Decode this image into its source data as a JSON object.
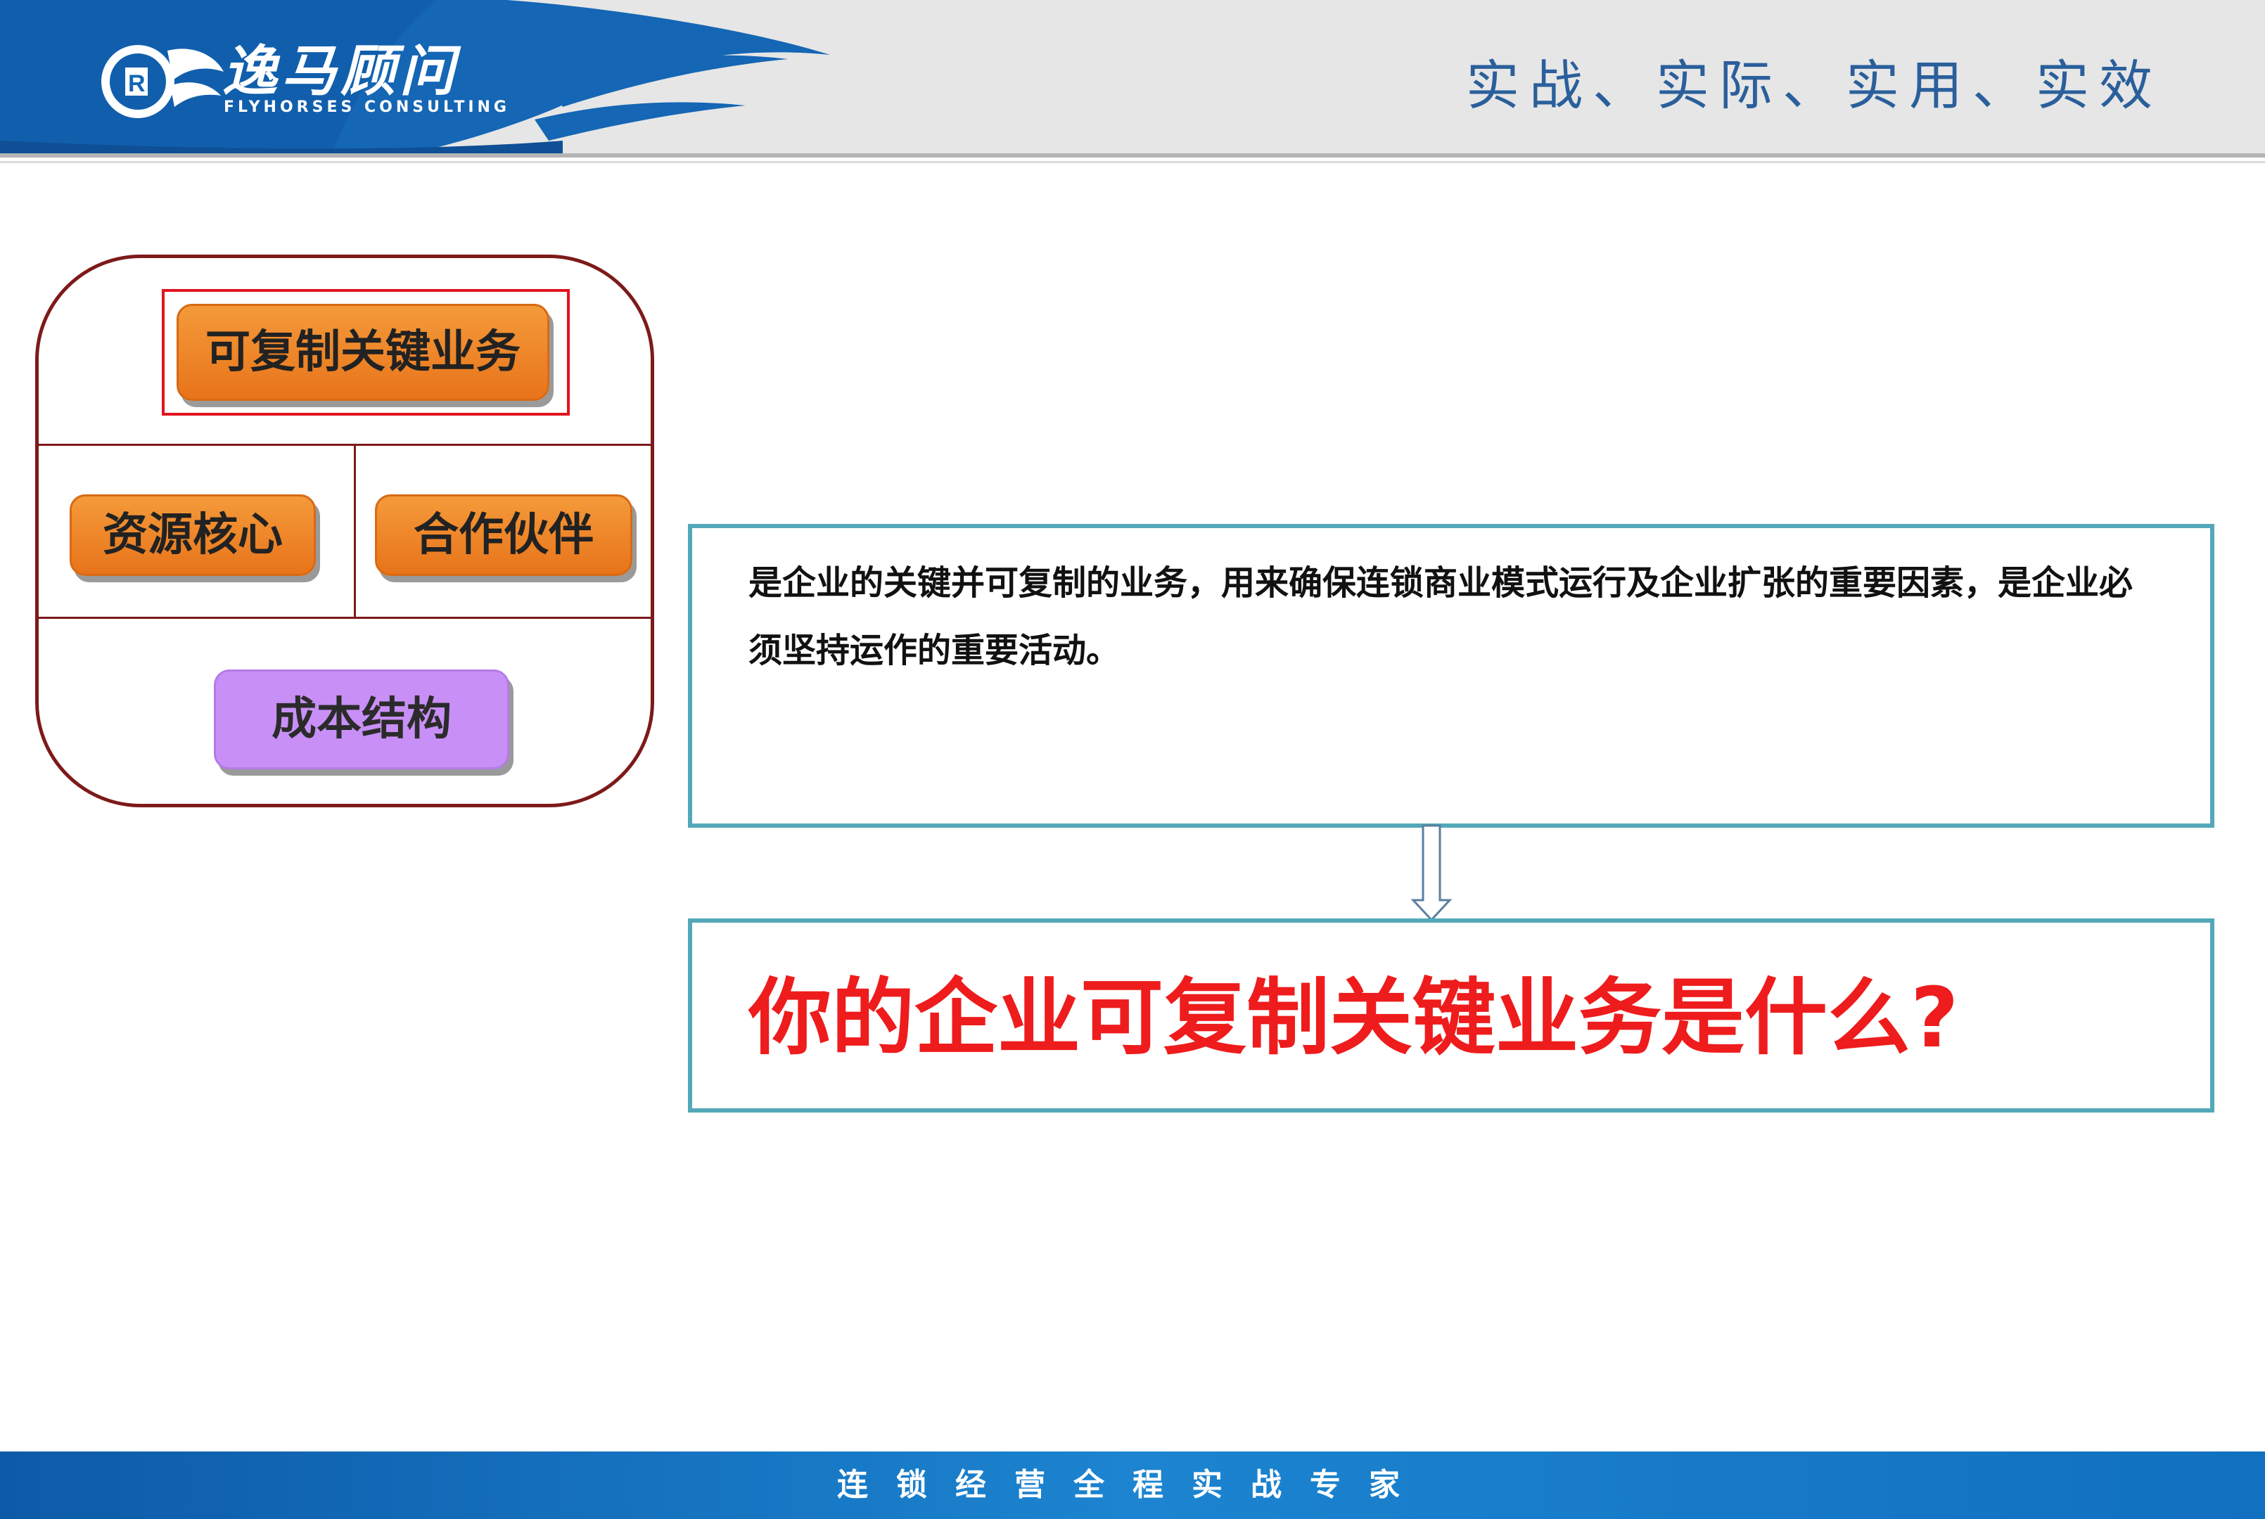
{
  "header": {
    "logo_text": "逸马顾问",
    "logo_subtext": "FLYHORSES CONSULTING",
    "tagline": "实战、实际、实用、实效"
  },
  "diagram": {
    "key_business": "可复制关键业务",
    "core_resources": "资源核心",
    "partners": "合作伙伴",
    "cost_structure": "成本结构"
  },
  "description": "是企业的关键并可复制的业务，用来确保连锁商业模式运行及企业扩张的重要因素，是企业必须坚持运作的重要活动。",
  "question": "你的企业可复制关键业务是什么?",
  "footer": {
    "text": "连锁经营全程实战专家"
  },
  "colors": {
    "header_blue": "#1566b4",
    "tagline_blue": "#2a5f9b",
    "orange_pill": "#f08a2a",
    "purple_pill": "#c890f6",
    "frame_maroon": "#7d1a1a",
    "highlight_red": "#e0141e",
    "box_teal": "#52a8b8",
    "question_red": "#ee1c1c"
  }
}
